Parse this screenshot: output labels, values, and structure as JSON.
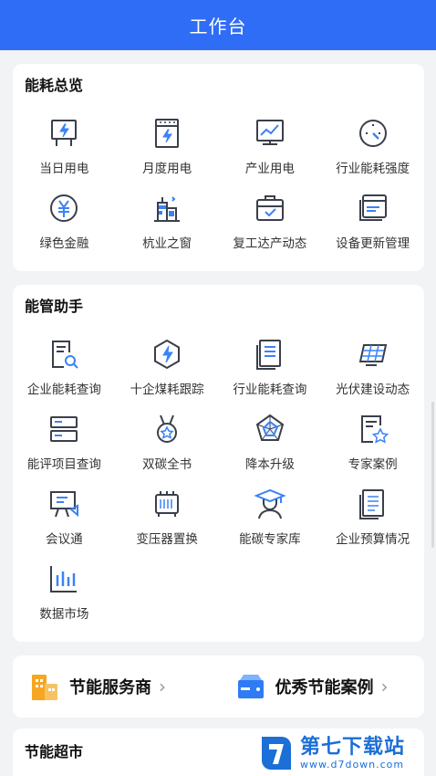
{
  "header": {
    "title": "工作台"
  },
  "overview": {
    "title": "能耗总览",
    "items": [
      {
        "label": "当日用电",
        "icon": "billboard-power-icon"
      },
      {
        "label": "月度用电",
        "icon": "monthly-power-icon"
      },
      {
        "label": "产业用电",
        "icon": "line-chart-icon"
      },
      {
        "label": "行业能耗强度",
        "icon": "gauge-icon"
      },
      {
        "label": "绿色金融",
        "icon": "yuan-coin-icon"
      },
      {
        "label": "杭业之窗",
        "icon": "city-buildings-icon"
      },
      {
        "label": "复工达产动态",
        "icon": "briefcase-check-icon"
      },
      {
        "label": "设备更新管理",
        "icon": "window-stack-icon"
      }
    ]
  },
  "assistant": {
    "title": "能管助手",
    "items": [
      {
        "label": "企业能耗查询",
        "icon": "document-search-icon"
      },
      {
        "label": "十企煤耗跟踪",
        "icon": "hexagon-bolt-icon"
      },
      {
        "label": "行业能耗查询",
        "icon": "document-list-icon"
      },
      {
        "label": "光伏建设动态",
        "icon": "solar-panel-icon"
      },
      {
        "label": "能评项目查询",
        "icon": "server-icon"
      },
      {
        "label": "双碳全书",
        "icon": "medal-star-icon"
      },
      {
        "label": "降本升级",
        "icon": "radar-chart-icon"
      },
      {
        "label": "专家案例",
        "icon": "document-star-icon"
      },
      {
        "label": "会议通",
        "icon": "presentation-icon"
      },
      {
        "label": "变压器置换",
        "icon": "transformer-icon"
      },
      {
        "label": "能碳专家库",
        "icon": "graduate-icon"
      },
      {
        "label": "企业预算情况",
        "icon": "budget-document-icon"
      },
      {
        "label": "数据市场",
        "icon": "bar-chart-icon"
      }
    ]
  },
  "services": [
    {
      "label": "节能服务商",
      "icon": "buildings-orange-icon",
      "chevron": "›"
    },
    {
      "label": "优秀节能案例",
      "icon": "storage-blue-icon",
      "chevron": "›"
    }
  ],
  "market": {
    "title": "节能超市"
  },
  "watermark": {
    "name": "第七下载站",
    "url": "www.d7down.com"
  },
  "colors": {
    "primary": "#2f6df6",
    "icon_stroke": "#3a3f4b",
    "accent_blue": "#3b82f6",
    "orange": "#f5a623"
  }
}
